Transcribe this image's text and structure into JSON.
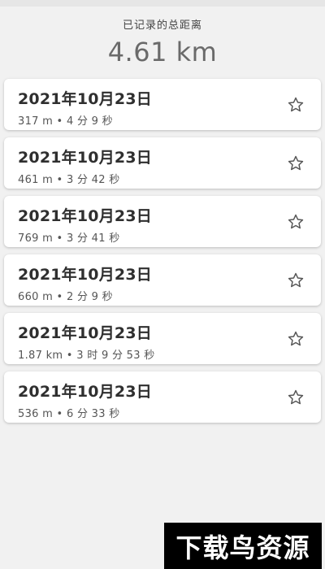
{
  "header": {
    "label": "已记录的总距离",
    "total": "4.61 km"
  },
  "records": [
    {
      "date": "2021年10月23日",
      "meta": "317 m • 4 分 9 秒"
    },
    {
      "date": "2021年10月23日",
      "meta": "461 m • 3 分 42 秒"
    },
    {
      "date": "2021年10月23日",
      "meta": "769 m • 3 分 41 秒"
    },
    {
      "date": "2021年10月23日",
      "meta": "660 m • 2 分 9 秒"
    },
    {
      "date": "2021年10月23日",
      "meta": "1.87 km • 3 时 9 分 53 秒"
    },
    {
      "date": "2021年10月23日",
      "meta": "536 m • 6 分 33 秒"
    }
  ],
  "icons": {
    "favorite": "star-outline-icon"
  },
  "watermark": {
    "text": "下载鸟资源"
  }
}
